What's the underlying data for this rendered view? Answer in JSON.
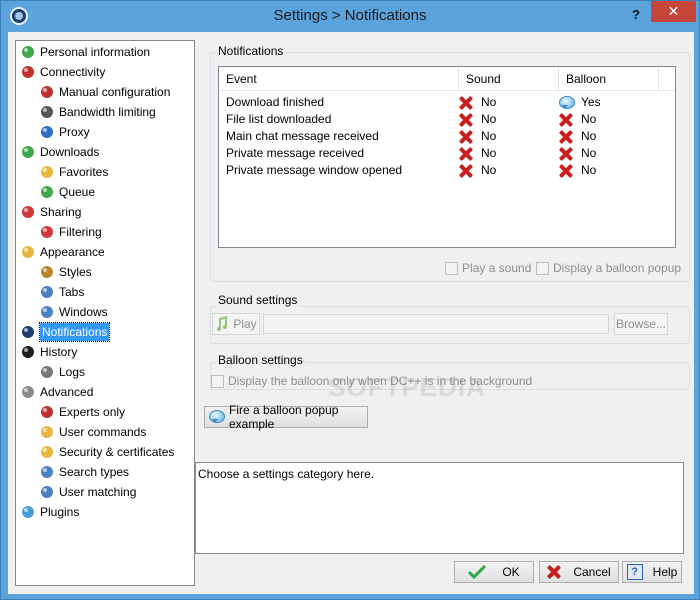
{
  "window": {
    "title": "Settings > Notifications",
    "help_glyph": "?",
    "close_glyph": "✕"
  },
  "tree": [
    {
      "label": "Personal information",
      "level": 0,
      "icon": "user-icon",
      "color": "#3fa84a"
    },
    {
      "label": "Connectivity",
      "level": 0,
      "icon": "antenna-icon",
      "color": "#c03030"
    },
    {
      "label": "Manual configuration",
      "level": 1,
      "icon": "antenna-icon",
      "color": "#c03030"
    },
    {
      "label": "Bandwidth limiting",
      "level": 1,
      "icon": "gauge-icon",
      "color": "#555555"
    },
    {
      "label": "Proxy",
      "level": 1,
      "icon": "globe-icon",
      "color": "#2f6fc4"
    },
    {
      "label": "Downloads",
      "level": 0,
      "icon": "arrow-down-icon",
      "color": "#3fa84a"
    },
    {
      "label": "Favorites",
      "level": 1,
      "icon": "folder-icon",
      "color": "#e6b640"
    },
    {
      "label": "Queue",
      "level": 1,
      "icon": "queue-icon",
      "color": "#3fa84a"
    },
    {
      "label": "Sharing",
      "level": 0,
      "icon": "arrow-up-icon",
      "color": "#d23a3a"
    },
    {
      "label": "Filtering",
      "level": 1,
      "icon": "arrow-up-icon",
      "color": "#d23a3a"
    },
    {
      "label": "Appearance",
      "level": 0,
      "icon": "palette-icon",
      "color": "#e6b640"
    },
    {
      "label": "Styles",
      "level": 1,
      "icon": "brush-icon",
      "color": "#b8862c"
    },
    {
      "label": "Tabs",
      "level": 1,
      "icon": "tabs-icon",
      "color": "#4a7fc0"
    },
    {
      "label": "Windows",
      "level": 1,
      "icon": "windows-icon",
      "color": "#4a7fc0"
    },
    {
      "label": "Notifications",
      "level": 0,
      "icon": "notification-icon",
      "color": "#1d3e6e",
      "selected": true
    },
    {
      "label": "History",
      "level": 0,
      "icon": "clock-icon",
      "color": "#1d1d1d"
    },
    {
      "label": "Logs",
      "level": 1,
      "icon": "log-icon",
      "color": "#777777"
    },
    {
      "label": "Advanced",
      "level": 0,
      "icon": "gear-icon",
      "color": "#8a8a8a"
    },
    {
      "label": "Experts only",
      "level": 1,
      "icon": "tools-icon",
      "color": "#c03030"
    },
    {
      "label": "User commands",
      "level": 1,
      "icon": "user-command-icon",
      "color": "#e6b640"
    },
    {
      "label": "Security & certificates",
      "level": 1,
      "icon": "lock-icon",
      "color": "#e6b640"
    },
    {
      "label": "Search types",
      "level": 1,
      "icon": "search-icon",
      "color": "#4a7fc0"
    },
    {
      "label": "User matching",
      "level": 1,
      "icon": "users-icon",
      "color": "#4a7fc0"
    },
    {
      "label": "Plugins",
      "level": 0,
      "icon": "plugin-icon",
      "color": "#4a9fd8"
    }
  ],
  "notifications": {
    "group_title": "Notifications",
    "columns": [
      "Event",
      "Sound",
      "Balloon"
    ],
    "rows": [
      {
        "event": "Download finished",
        "sound": "No",
        "balloon": "Yes",
        "balloon_on": true
      },
      {
        "event": "File list downloaded",
        "sound": "No",
        "balloon": "No",
        "balloon_on": false
      },
      {
        "event": "Main chat message received",
        "sound": "No",
        "balloon": "No",
        "balloon_on": false
      },
      {
        "event": "Private message received",
        "sound": "No",
        "balloon": "No",
        "balloon_on": false
      },
      {
        "event": "Private message window opened",
        "sound": "No",
        "balloon": "No",
        "balloon_on": false
      }
    ],
    "play_sound_label": "Play a sound",
    "display_balloon_label": "Display a balloon popup"
  },
  "sound_settings": {
    "group_title": "Sound settings",
    "play_label": "Play",
    "path_value": "",
    "browse_label": "Browse..."
  },
  "balloon_settings": {
    "group_title": "Balloon settings",
    "background_only_label": "Display the balloon only when DC++ is in the background",
    "fire_example_label": "Fire a balloon popup example"
  },
  "info_text": "Choose a settings category here.",
  "watermark": "SOFTPEDIA",
  "footer": {
    "ok_label": "OK",
    "cancel_label": "Cancel",
    "help_label": "Help"
  }
}
